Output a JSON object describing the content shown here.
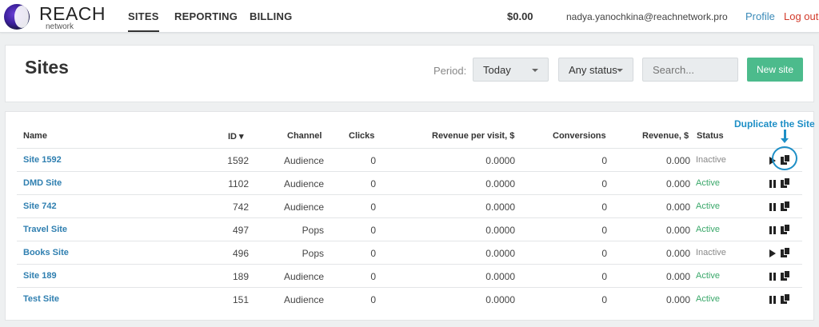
{
  "nav": {
    "brand_title": "REACH",
    "brand_sub": "network",
    "items": [
      "SITES",
      "REPORTING",
      "BILLING"
    ],
    "balance": "$0.00",
    "email": "nadya.yanochkina@reachnetwork.pro",
    "profile": "Profile",
    "logout": "Log out"
  },
  "header": {
    "title": "Sites",
    "period_label": "Period:",
    "period_value": "Today",
    "status_value": "Any status",
    "search_placeholder": "Search...",
    "new_button": "New site"
  },
  "table": {
    "columns": [
      "Name",
      "ID ▾",
      "Channel",
      "Clicks",
      "Revenue per visit, $",
      "Conversions",
      "Revenue, $",
      "Status"
    ],
    "rows": [
      {
        "name": "Site 1592",
        "id": "1592",
        "channel": "Audience",
        "clicks": "0",
        "rpv": "0.0000",
        "conversions": "0",
        "revenue": "0.000",
        "status": "Inactive",
        "control": "play"
      },
      {
        "name": "DMD Site",
        "id": "1102",
        "channel": "Audience",
        "clicks": "0",
        "rpv": "0.0000",
        "conversions": "0",
        "revenue": "0.000",
        "status": "Active",
        "control": "pause"
      },
      {
        "name": "Site 742",
        "id": "742",
        "channel": "Audience",
        "clicks": "0",
        "rpv": "0.0000",
        "conversions": "0",
        "revenue": "0.000",
        "status": "Active",
        "control": "pause"
      },
      {
        "name": "Travel Site",
        "id": "497",
        "channel": "Pops",
        "clicks": "0",
        "rpv": "0.0000",
        "conversions": "0",
        "revenue": "0.000",
        "status": "Active",
        "control": "pause"
      },
      {
        "name": "Books Site",
        "id": "496",
        "channel": "Pops",
        "clicks": "0",
        "rpv": "0.0000",
        "conversions": "0",
        "revenue": "0.000",
        "status": "Inactive",
        "control": "play"
      },
      {
        "name": "Site 189",
        "id": "189",
        "channel": "Audience",
        "clicks": "0",
        "rpv": "0.0000",
        "conversions": "0",
        "revenue": "0.000",
        "status": "Active",
        "control": "pause"
      },
      {
        "name": "Test Site",
        "id": "151",
        "channel": "Audience",
        "clicks": "0",
        "rpv": "0.0000",
        "conversions": "0",
        "revenue": "0.000",
        "status": "Active",
        "control": "pause"
      }
    ]
  },
  "annotation": {
    "text": "Duplicate the Site",
    "color": "#1e8fc6"
  },
  "colors": {
    "accent_green": "#4cbb8c",
    "link_blue": "#2f7fb0",
    "logout_red": "#d23a2a",
    "active_green": "#3aa86a"
  }
}
